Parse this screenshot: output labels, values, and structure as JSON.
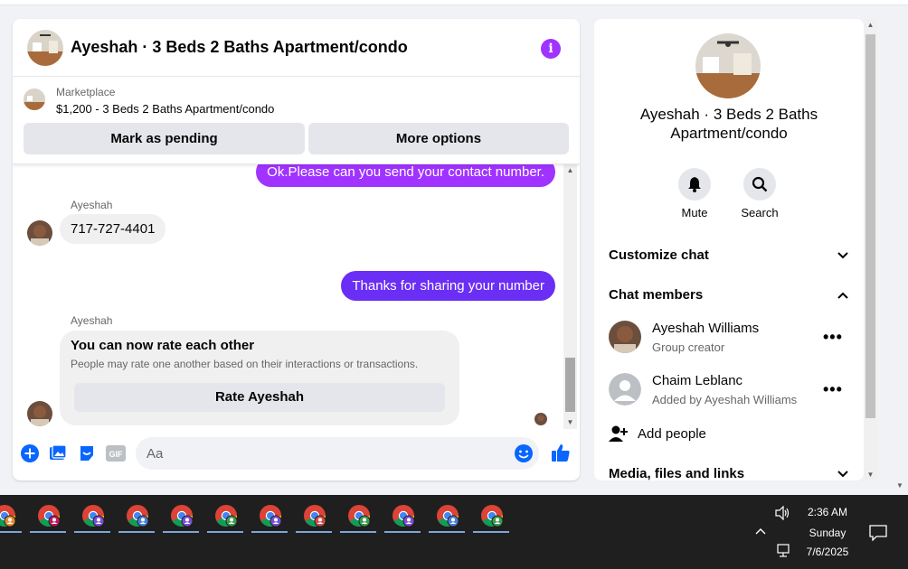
{
  "chat": {
    "title": "Ayeshah · 3 Beds 2 Baths Apartment/condo",
    "info_icon": "i",
    "marketplace": {
      "label": "Marketplace",
      "item": "$1,200 - 3 Beds 2 Baths Apartment/condo",
      "pending_button": "Mark as pending",
      "more_button": "More options"
    },
    "messages": [
      {
        "direction": "outgoing",
        "text": "Ok.Please can you send your contact number."
      },
      {
        "direction": "incoming",
        "sender": "Ayeshah",
        "text": "717-727-4401"
      },
      {
        "direction": "outgoing",
        "text": "Thanks for sharing your number"
      }
    ],
    "rating_card": {
      "sender": "Ayeshah",
      "title": "You can now rate each other",
      "subtitle": "People may rate one another based on their interactions or transactions.",
      "button": "Rate Ayeshah"
    },
    "composer": {
      "placeholder": "Aa",
      "icons": [
        "plus-icon",
        "photo-icon",
        "sticker-icon",
        "gif-icon",
        "emoji-icon",
        "like-icon"
      ]
    }
  },
  "details": {
    "title": "Ayeshah · 3 Beds 2 Baths Apartment/condo",
    "actions": [
      {
        "label": "Mute",
        "icon": "bell-icon"
      },
      {
        "label": "Search",
        "icon": "search-icon"
      }
    ],
    "sections": {
      "customize": "Customize chat",
      "members": "Chat members",
      "media": "Media, files and links"
    },
    "members": [
      {
        "name": "Ayeshah Williams",
        "role": "Group creator"
      },
      {
        "name": "Chaim Leblanc",
        "role": "Added by Ayeshah Williams"
      }
    ],
    "add_people": "Add people",
    "more_icon": "•••"
  },
  "taskbar": {
    "app_count": 12,
    "time": "2:36 AM",
    "day": "Sunday",
    "date": "7/6/2025"
  },
  "colors": {
    "accent": "#a033ff",
    "outgoing_second": "#6b2ef5",
    "messenger_blue": "#0866ff",
    "taskbar": "#1f1f1f"
  }
}
